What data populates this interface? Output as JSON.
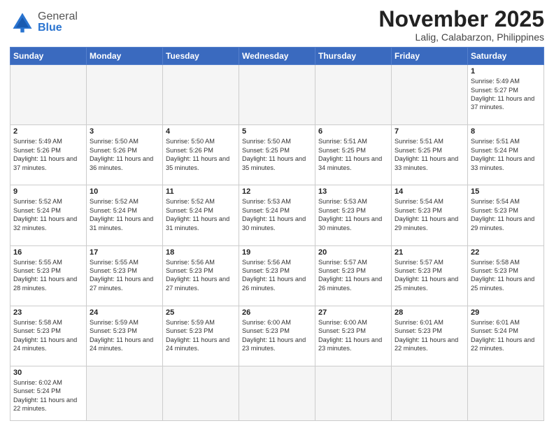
{
  "header": {
    "logo": {
      "general": "General",
      "blue": "Blue"
    },
    "title": "November 2025",
    "location": "Lalig, Calabarzon, Philippines"
  },
  "weekdays": [
    "Sunday",
    "Monday",
    "Tuesday",
    "Wednesday",
    "Thursday",
    "Friday",
    "Saturday"
  ],
  "days": {
    "1": {
      "sunrise": "5:49 AM",
      "sunset": "5:27 PM",
      "daylight": "11 hours and 37 minutes."
    },
    "2": {
      "sunrise": "5:49 AM",
      "sunset": "5:26 PM",
      "daylight": "11 hours and 37 minutes."
    },
    "3": {
      "sunrise": "5:50 AM",
      "sunset": "5:26 PM",
      "daylight": "11 hours and 36 minutes."
    },
    "4": {
      "sunrise": "5:50 AM",
      "sunset": "5:26 PM",
      "daylight": "11 hours and 35 minutes."
    },
    "5": {
      "sunrise": "5:50 AM",
      "sunset": "5:25 PM",
      "daylight": "11 hours and 35 minutes."
    },
    "6": {
      "sunrise": "5:51 AM",
      "sunset": "5:25 PM",
      "daylight": "11 hours and 34 minutes."
    },
    "7": {
      "sunrise": "5:51 AM",
      "sunset": "5:25 PM",
      "daylight": "11 hours and 33 minutes."
    },
    "8": {
      "sunrise": "5:51 AM",
      "sunset": "5:24 PM",
      "daylight": "11 hours and 33 minutes."
    },
    "9": {
      "sunrise": "5:52 AM",
      "sunset": "5:24 PM",
      "daylight": "11 hours and 32 minutes."
    },
    "10": {
      "sunrise": "5:52 AM",
      "sunset": "5:24 PM",
      "daylight": "11 hours and 31 minutes."
    },
    "11": {
      "sunrise": "5:52 AM",
      "sunset": "5:24 PM",
      "daylight": "11 hours and 31 minutes."
    },
    "12": {
      "sunrise": "5:53 AM",
      "sunset": "5:24 PM",
      "daylight": "11 hours and 30 minutes."
    },
    "13": {
      "sunrise": "5:53 AM",
      "sunset": "5:23 PM",
      "daylight": "11 hours and 30 minutes."
    },
    "14": {
      "sunrise": "5:54 AM",
      "sunset": "5:23 PM",
      "daylight": "11 hours and 29 minutes."
    },
    "15": {
      "sunrise": "5:54 AM",
      "sunset": "5:23 PM",
      "daylight": "11 hours and 29 minutes."
    },
    "16": {
      "sunrise": "5:55 AM",
      "sunset": "5:23 PM",
      "daylight": "11 hours and 28 minutes."
    },
    "17": {
      "sunrise": "5:55 AM",
      "sunset": "5:23 PM",
      "daylight": "11 hours and 27 minutes."
    },
    "18": {
      "sunrise": "5:56 AM",
      "sunset": "5:23 PM",
      "daylight": "11 hours and 27 minutes."
    },
    "19": {
      "sunrise": "5:56 AM",
      "sunset": "5:23 PM",
      "daylight": "11 hours and 26 minutes."
    },
    "20": {
      "sunrise": "5:57 AM",
      "sunset": "5:23 PM",
      "daylight": "11 hours and 26 minutes."
    },
    "21": {
      "sunrise": "5:57 AM",
      "sunset": "5:23 PM",
      "daylight": "11 hours and 25 minutes."
    },
    "22": {
      "sunrise": "5:58 AM",
      "sunset": "5:23 PM",
      "daylight": "11 hours and 25 minutes."
    },
    "23": {
      "sunrise": "5:58 AM",
      "sunset": "5:23 PM",
      "daylight": "11 hours and 24 minutes."
    },
    "24": {
      "sunrise": "5:59 AM",
      "sunset": "5:23 PM",
      "daylight": "11 hours and 24 minutes."
    },
    "25": {
      "sunrise": "5:59 AM",
      "sunset": "5:23 PM",
      "daylight": "11 hours and 24 minutes."
    },
    "26": {
      "sunrise": "6:00 AM",
      "sunset": "5:23 PM",
      "daylight": "11 hours and 23 minutes."
    },
    "27": {
      "sunrise": "6:00 AM",
      "sunset": "5:23 PM",
      "daylight": "11 hours and 23 minutes."
    },
    "28": {
      "sunrise": "6:01 AM",
      "sunset": "5:23 PM",
      "daylight": "11 hours and 22 minutes."
    },
    "29": {
      "sunrise": "6:01 AM",
      "sunset": "5:24 PM",
      "daylight": "11 hours and 22 minutes."
    },
    "30": {
      "sunrise": "6:02 AM",
      "sunset": "5:24 PM",
      "daylight": "11 hours and 22 minutes."
    }
  },
  "labels": {
    "sunrise_prefix": "Sunrise: ",
    "sunset_prefix": "Sunset: ",
    "daylight_prefix": "Daylight: "
  }
}
